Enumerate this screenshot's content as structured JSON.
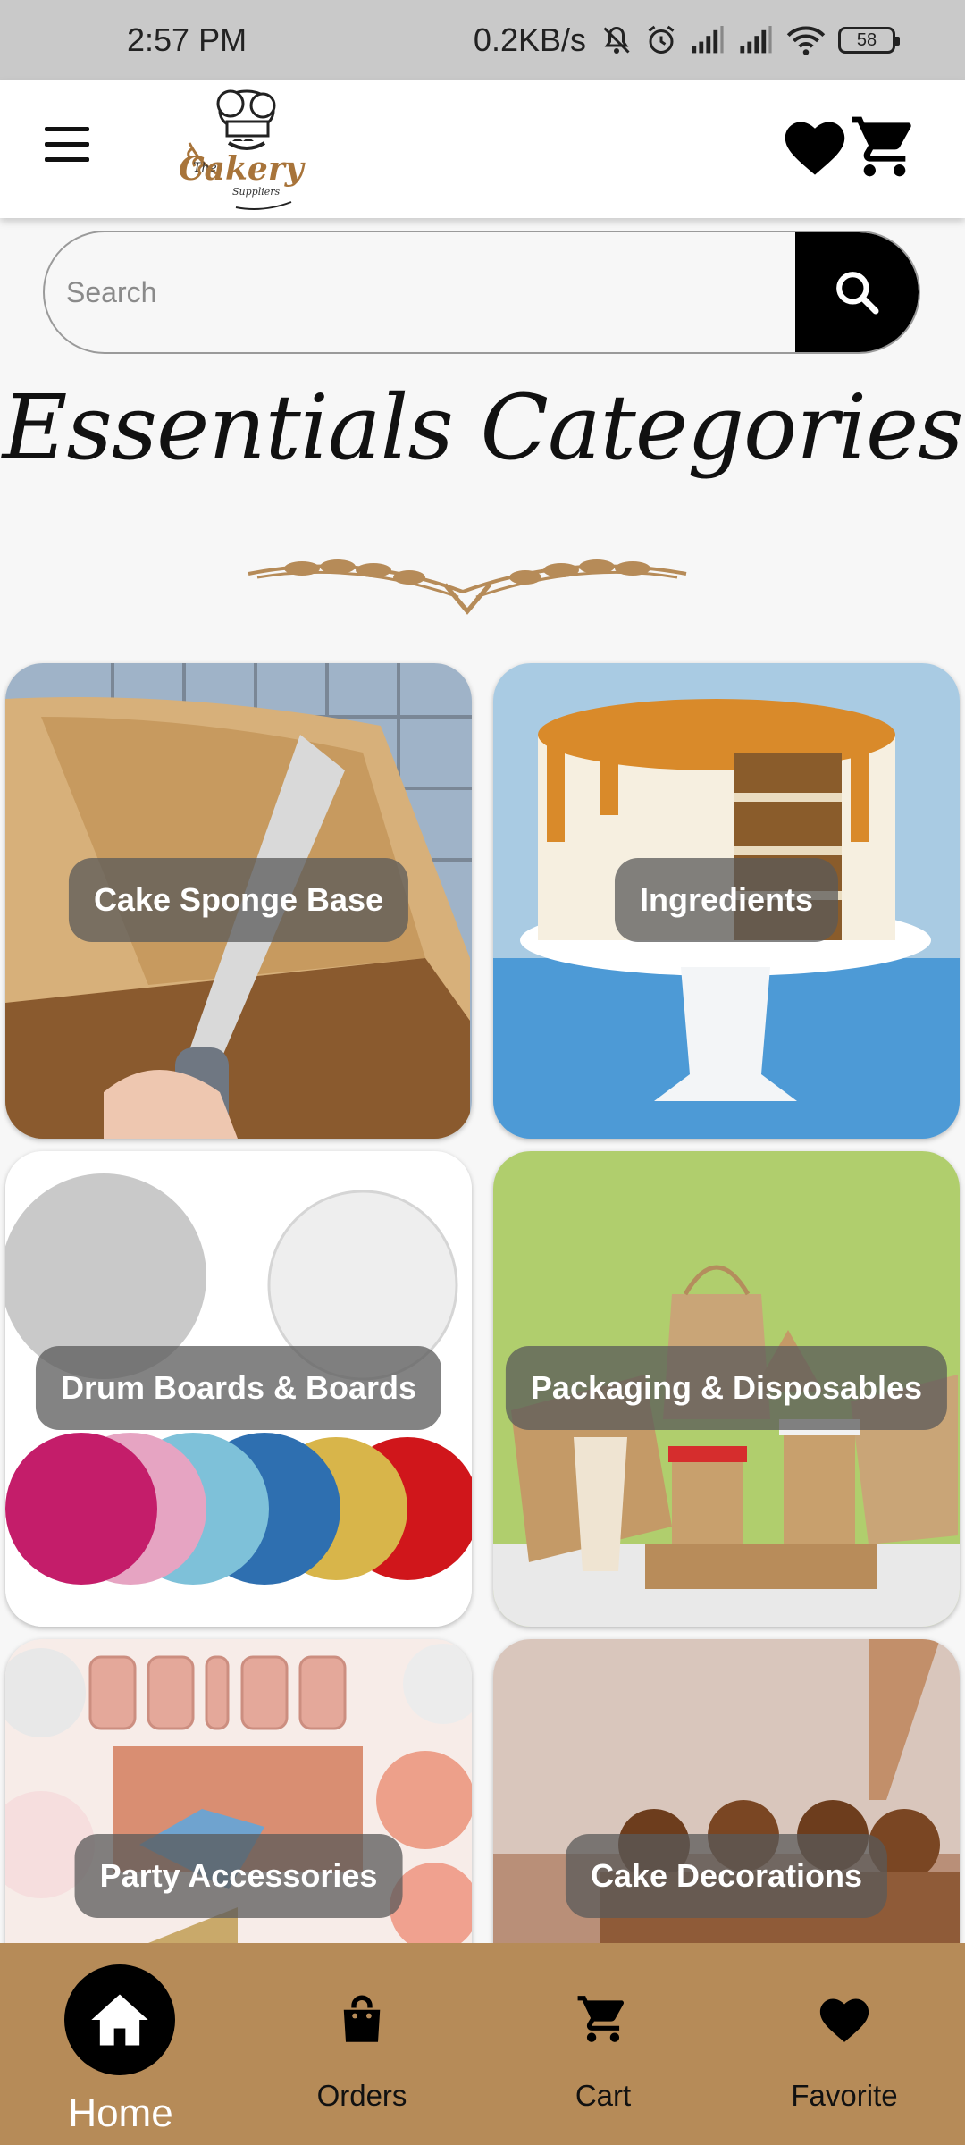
{
  "status_bar": {
    "time": "2:57 PM",
    "net_speed": "0.2KB/s",
    "battery": "58",
    "icons": [
      "mute-icon",
      "alarm-icon",
      "signal-icon",
      "signal-icon",
      "wifi-icon",
      "battery-icon"
    ]
  },
  "header": {
    "logo_the": "The",
    "logo_name": "Cakery",
    "logo_sub": "Suppliers",
    "icons": [
      "menu-icon",
      "heart-icon",
      "cart-icon"
    ]
  },
  "search": {
    "placeholder": "Search",
    "value": ""
  },
  "section": {
    "title": "Essentials Categories"
  },
  "categories": [
    {
      "label": "Cake Sponge Base"
    },
    {
      "label": "Ingredients"
    },
    {
      "label": "Drum Boards & Boards"
    },
    {
      "label": "Packaging & Disposables"
    },
    {
      "label": "Party Accessories"
    },
    {
      "label": "Cake Decorations"
    }
  ],
  "bottom_nav": {
    "items": [
      {
        "label": "Home",
        "icon": "home-icon",
        "active": true
      },
      {
        "label": "Orders",
        "icon": "bag-icon"
      },
      {
        "label": "Cart",
        "icon": "cart-icon"
      },
      {
        "label": "Favorite",
        "icon": "heart-icon"
      }
    ]
  },
  "colors": {
    "nav_bg": "#b68b58",
    "accent_brown": "#a8743a",
    "search_button": "#000000"
  }
}
